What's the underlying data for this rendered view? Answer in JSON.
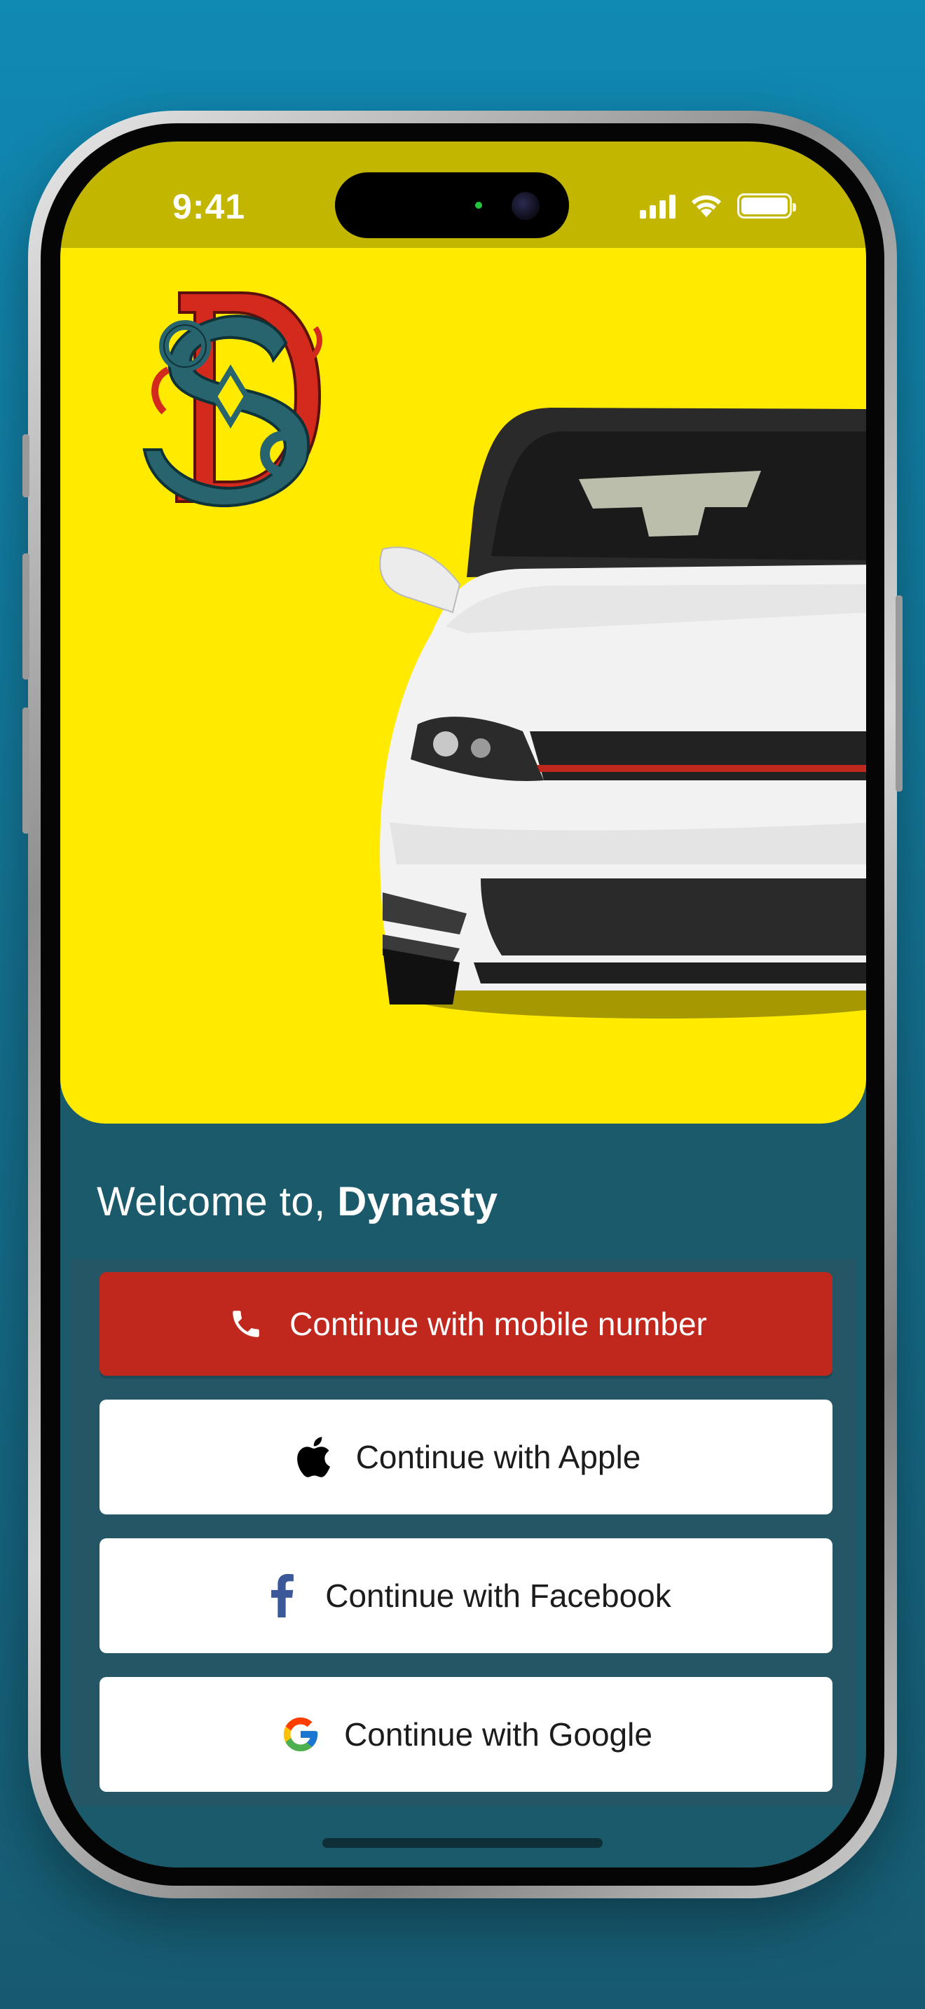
{
  "status_bar": {
    "time": "9:41"
  },
  "welcome": {
    "prefix": "Welcome to, ",
    "app_name": "Dynasty"
  },
  "buttons": {
    "mobile": "Continue with mobile number",
    "apple": "Continue with Apple",
    "facebook": "Continue with Facebook",
    "google": "Continue with Google"
  },
  "colors": {
    "background": "#1089b3",
    "status_bar": "#c2b600",
    "hero": "#ffea00",
    "screen": "#1b5a6b",
    "mobile_button": "#c0271d",
    "facebook_blue": "#3b5998"
  },
  "icons": {
    "phone": "phone-icon",
    "apple": "apple-icon",
    "facebook": "facebook-icon",
    "google": "google-icon",
    "brand": "dynasty-monogram-icon"
  }
}
